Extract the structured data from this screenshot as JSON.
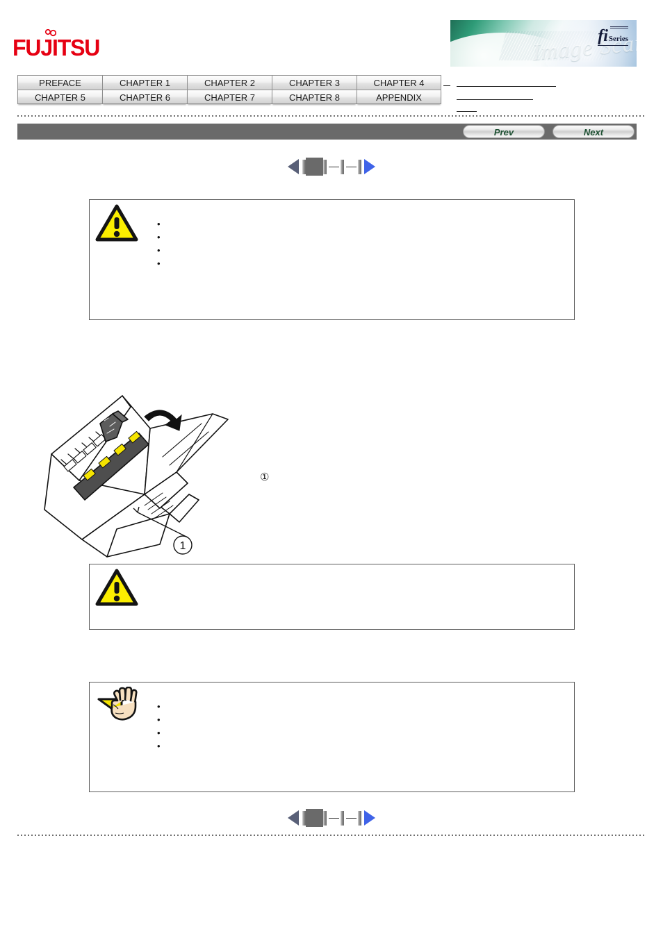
{
  "brand": {
    "logo_text": "FUJITSU",
    "logo_mark": "infinity-mark"
  },
  "banner": {
    "fi_text": "fi",
    "series_text": "Series",
    "scanner_word": "Image Scanner",
    "alt": "fi-series-image-scanner-banner"
  },
  "chapter_tabs": {
    "row1": [
      "PREFACE",
      "CHAPTER 1",
      "CHAPTER 2",
      "CHAPTER 3",
      "CHAPTER 4"
    ],
    "row2": [
      "CHAPTER 5",
      "CHAPTER 6",
      "CHAPTER 7",
      "CHAPTER 8",
      "APPENDIX"
    ]
  },
  "breadcrumb": {
    "dash": "",
    "line1": "",
    "line2": "",
    "line3": ""
  },
  "toolbar": {
    "prev_label": "Prev",
    "next_label": "Next"
  },
  "page_nav": {
    "prev_icon": "triangle-left-icon",
    "next_icon": "triangle-right-icon",
    "current_page_indicator": "",
    "tick_icon": "page-tick",
    "gap_icon": "page-gap-dash"
  },
  "content": {
    "warning_1": {
      "icon": "caution-triangle-icon",
      "heading": "",
      "bullets": [
        "",
        "",
        ""
      ]
    },
    "body_text_1": "",
    "figure": {
      "name": "scanner-adf-open-illustration",
      "callout_label": "1",
      "arrow": "rotate-arrow"
    },
    "step_marker": "①",
    "step_text": "",
    "warning_2": {
      "icon": "caution-triangle-icon",
      "heading": ""
    },
    "body_text_2": "",
    "hint": {
      "icon": "hand-attention-icon",
      "heading": "",
      "bullets": [
        "",
        ""
      ]
    }
  },
  "colors": {
    "brand_red": "#e60012",
    "toolbar_gray": "#6a6a6a",
    "next_blue": "#3f63e8",
    "prev_slate": "#596078",
    "caution_yellow": "#fbee00",
    "button_green_text": "#1d5032"
  }
}
